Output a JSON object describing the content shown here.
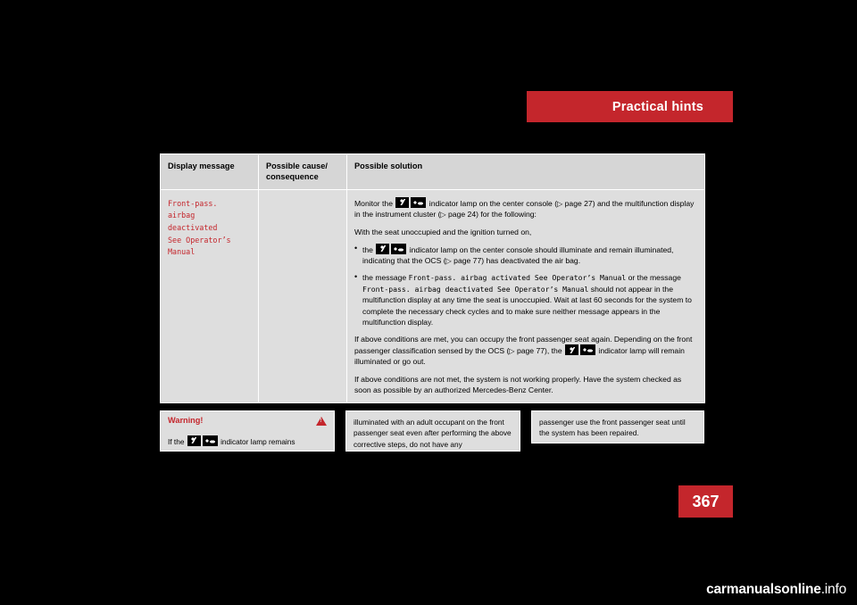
{
  "header": {
    "chapter_title": "Practical hints"
  },
  "table": {
    "columns": [
      "Display message",
      "Possible cause/\nconsequence",
      "Possible solution"
    ],
    "row": {
      "display_message": "Front-pass.\nairbag\ndeactivated\nSee Operator’s\nManual",
      "possible_cause": "",
      "solution": {
        "p1_before": "Monitor the",
        "p1_after": "indicator lamp on the center console (",
        "p1_ref1": "page 27",
        "p1_mid": ") and the multifunction display in the instrument cluster (",
        "p1_ref2": "page 24",
        "p1_end": ") for the following:",
        "p2": "With the seat unoccupied and the ignition turned on,",
        "b1_before": "the",
        "b1_after": "indicator lamp on the center console should illuminate and remain illuminated, indicating that the OCS (",
        "b1_ref": "page 77",
        "b1_end": ") has deactivated the air bag.",
        "b2_before": "the message",
        "b2_mono1": "Front-pass. airbag activated See Operator’s Manual",
        "b2_mid": "or the message",
        "b2_mono2": "Front-pass. airbag deactivated See Operator’s Manual",
        "b2_end": "should not appear in the multifunction display at any time the seat is unoccupied. Wait at last 60 seconds for the system to complete the necessary check cycles and to make sure neither message appears in the multifunction display.",
        "p3_before": "If above conditions are met, you can occupy the front passenger seat again. Depending on the front passenger classification sensed by the OCS (",
        "p3_ref": "page 77",
        "p3_after": "), the",
        "p3_end": "indicator lamp will remain illuminated or go out.",
        "p4": "If above conditions are not met, the system is not working properly. Have the system checked as soon as possible by an authorized Mercedes-Benz Center."
      }
    }
  },
  "warning": {
    "title": "Warning!",
    "box1_before": "If the",
    "box1_after": "indicator lamp remains",
    "box2": "illuminated with an adult occupant on the front passenger seat even after performing the above corrective steps, do not have any",
    "box3": "passenger use the front passenger seat until the system has been repaired."
  },
  "footer": {
    "page_number": "367",
    "watermark_plain": "carmanualsonline",
    "watermark_suffix": ".info"
  },
  "colors": {
    "accent_red": "#c4262c",
    "panel_gray": "#dedede",
    "header_gray": "#d6d6d6",
    "background": "#000000"
  }
}
